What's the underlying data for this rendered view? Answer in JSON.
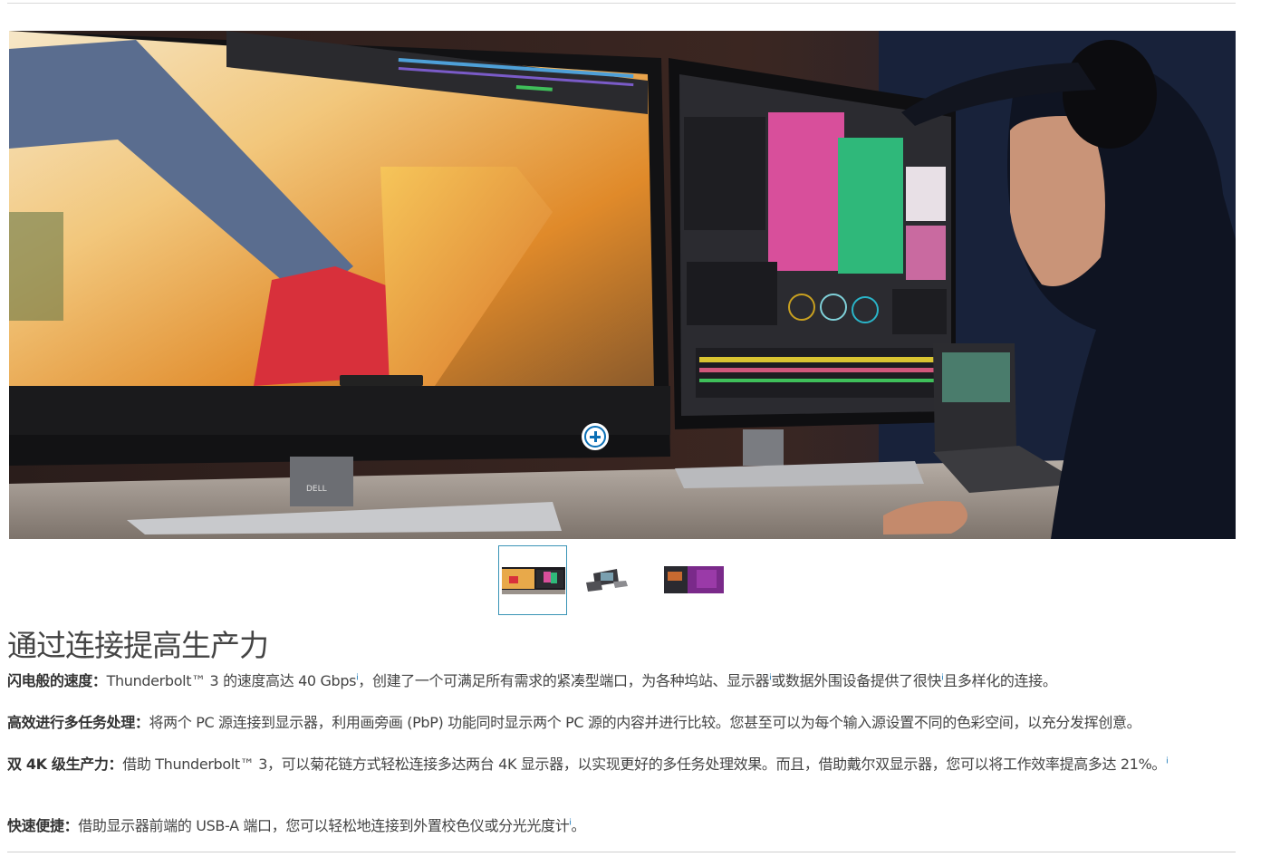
{
  "hero": {
    "thumbnails": [
      {
        "name": "thumbnail-1",
        "active": true
      },
      {
        "name": "thumbnail-2",
        "active": false
      },
      {
        "name": "thumbnail-3",
        "active": false
      }
    ],
    "zoom_icon": "plus-circle-icon",
    "monitor_brand": "DELL"
  },
  "section": {
    "title": "通过连接提高生产力",
    "paragraphs": [
      {
        "lead": "闪电般的速度：",
        "parts": [
          "Thunderbolt™ 3 的速度高达 40 Gbps",
          "i",
          "，创建了一个可满足所有需求的紧凑型端口，为各种坞站、显示器",
          "i",
          "或数据外围设备提供了很快",
          "i",
          "且多样化的连接。"
        ]
      },
      {
        "lead": "高效进行多任务处理：",
        "parts": [
          "将两个 PC 源连接到显示器，利用画旁画 (PbP) 功能同时显示两个 PC 源的内容并进行比较。您甚至可以为每个输入源设置不同的色彩空间，以充分发挥创意。"
        ]
      },
      {
        "lead": "双 4K 级生产力：",
        "parts": [
          "借助 Thunderbolt™ 3，可以菊花链方式轻松连接多达两台 4K 显示器，以实现更好的多任务处理效果。而且，借助戴尔双显示器，您可以将工作效率提高多达 21%。",
          "i"
        ]
      },
      {
        "lead": "快速便捷：",
        "parts": [
          "借助显示器前端的 USB-A 端口，您可以轻松地连接到外置校色仪或分光光度计",
          "i",
          "。"
        ]
      }
    ]
  }
}
